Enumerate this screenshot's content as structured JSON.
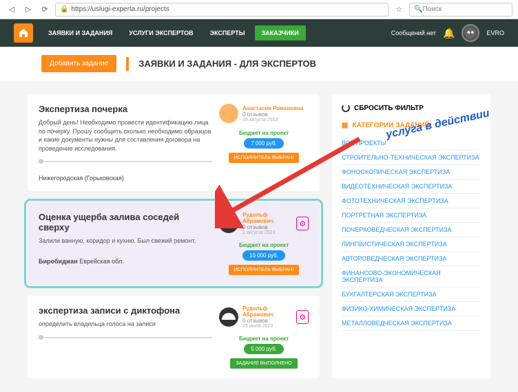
{
  "browser": {
    "url": "https://uslugi-experta.ru/projects",
    "search_placeholder": "Поиск"
  },
  "nav": {
    "items": [
      "ЗАЯВКИ И ЗАДАНИЯ",
      "УСЛУГИ ЭКСПЕРТОВ",
      "ЭКСПЕРТЫ",
      "ЗАКАЗЧИКИ"
    ],
    "messages": "Сообщений нет",
    "username": "EVRO"
  },
  "subheader": {
    "add_btn": "Добавить задание",
    "title": "ЗАЯВКИ И ЗАДАНИЯ - ДЛЯ ЭКСПЕРТОВ"
  },
  "cards": [
    {
      "title": "Экспертиза почерка",
      "desc": "Добрый день! Необходимо провести идентификацию лица по почерку. Прошу сообщить сколько необходимо образцов и какие документы нужны для составления договора на проведение исследования.",
      "location": "Нижегородская (Горьковская)",
      "user_name": "Анастасия Романовна",
      "reviews": "0 отзывов",
      "date": "29 августа 2023",
      "budget_label": "Бюджет на проект",
      "price": "7 000 руб.",
      "status": "ИСПОЛНИТЕЛЬ ВЫБРАН!"
    },
    {
      "title": "Оценка ущерба залива соседей сверху",
      "desc": "Залили ванную, коридор и кухню. Был свежий ремонт.",
      "location_bold": "Биробиджан",
      "location_rest": " Еврейская обл.",
      "user_name": "Рудольф Абрамович",
      "reviews": "0 отзывов",
      "date": "1 августа 2023",
      "budget_label": "Бюджет на проект",
      "price": "10 000 руб.",
      "status": "ИСПОЛНИТЕЛЬ ВЫБРАН!"
    },
    {
      "title": "экспертиза записи с диктофона",
      "desc": "определить владельца голоса на записи",
      "user_name": "Рудольф Абрамович",
      "reviews": "0 отзывов",
      "date": "25 июля 2023",
      "budget_label": "Бюджет на проект",
      "price": "5 000 руб.",
      "status": "ЗАДАНИЕ ВЫПОЛНЕНО"
    }
  ],
  "sidebar": {
    "reset": "СБРОСИТЬ ФИЛЬТР",
    "cat_header": "КАТЕГОРИИ ЗАДАНИЙ",
    "items": [
      "ВСЕ ПРОЕКТЫ",
      "СТРОИТЕЛЬНО-ТЕХНИЧЕСКАЯ ЭКСПЕРТИЗА",
      "ФОНОСКОПИЧЕСКАЯ ЭКСПЕРТИЗА",
      "ВИДЕОТЕХНИЧЕСКАЯ ЭКСПЕРТИЗА",
      "ФОТОТЕХНИЧЕСКАЯ ЭКСПЕРТИЗА",
      "ПОРТРЕТНАЯ ЭКСПЕРТИЗА",
      "ПОЧЕРКОВЕДЧЕСКАЯ ЭКСПЕРТИЗА",
      "ЛИНГВИСТИЧЕСКАЯ ЭКСПЕРТИЗА",
      "АВТОРОВЕДЧЕСКАЯ ЭКСПЕРТИЗА",
      "ФИНАНСОВО-ЭКОНОМИЧЕСКАЯ ЭКСПЕРТИЗА",
      "БУХГАЛТЕРСКАЯ ЭКСПЕРТИЗА",
      "ФИЗИКО-ХИМИЧЕСКАЯ ЭКСПЕРТИЗА",
      "МЕТАЛЛОВЕДЧЕСКАЯ ЭКСПЕРТИЗА"
    ]
  },
  "annotation": "услуга в действии"
}
